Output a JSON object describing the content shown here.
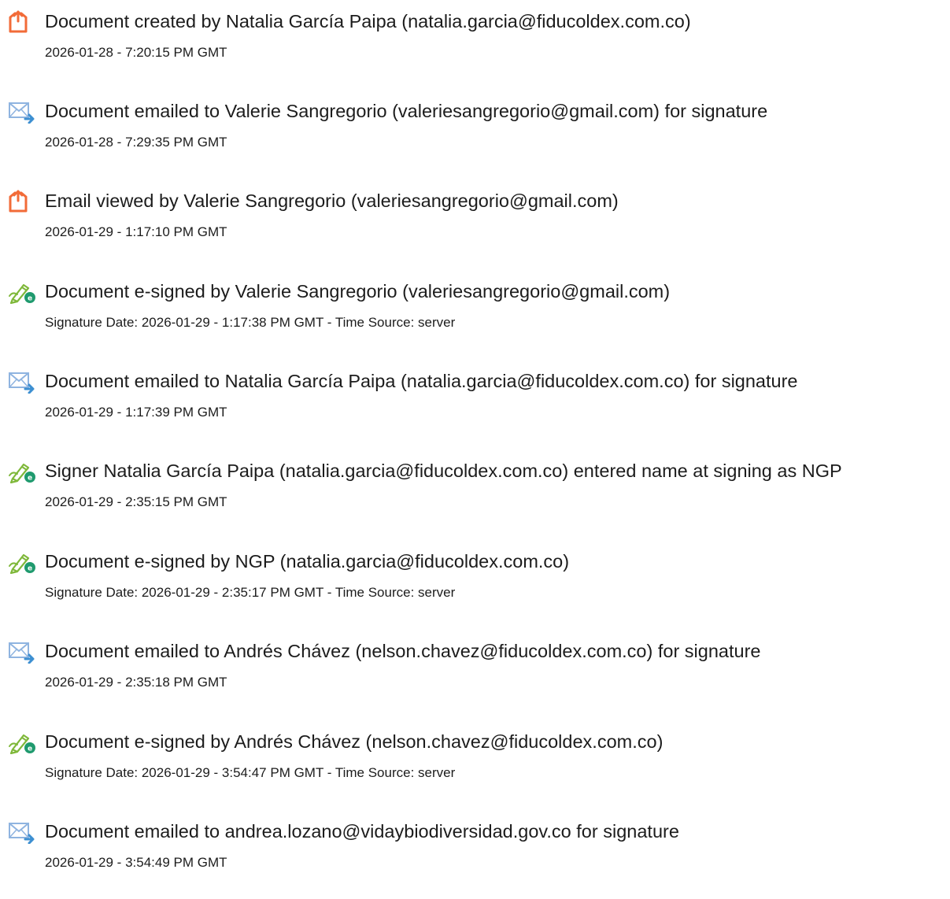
{
  "events": [
    {
      "icon": "document-created-icon",
      "description": "Document created by Natalia García Paipa (natalia.garcia@fiducoldex.com.co)",
      "timestamp": "2026-01-28 - 7:20:15 PM GMT"
    },
    {
      "icon": "email-sent-icon",
      "description": "Document emailed to Valerie Sangregorio (valeriesangregorio@gmail.com) for signature",
      "timestamp": "2026-01-28 - 7:29:35 PM GMT"
    },
    {
      "icon": "document-viewed-icon",
      "description": "Email viewed by Valerie Sangregorio (valeriesangregorio@gmail.com)",
      "timestamp": "2026-01-29 - 1:17:10 PM GMT"
    },
    {
      "icon": "e-sign-icon",
      "description": "Document e-signed by Valerie Sangregorio (valeriesangregorio@gmail.com)",
      "timestamp": "Signature Date: 2026-01-29 - 1:17:38 PM GMT - Time Source: server"
    },
    {
      "icon": "email-sent-icon",
      "description": "Document emailed to Natalia García Paipa (natalia.garcia@fiducoldex.com.co) for signature",
      "timestamp": "2026-01-29 - 1:17:39 PM GMT"
    },
    {
      "icon": "e-sign-icon",
      "description": "Signer Natalia García Paipa (natalia.garcia@fiducoldex.com.co) entered name at signing as NGP",
      "timestamp": "2026-01-29 - 2:35:15 PM GMT"
    },
    {
      "icon": "e-sign-icon",
      "description": "Document e-signed by NGP (natalia.garcia@fiducoldex.com.co)",
      "timestamp": "Signature Date: 2026-01-29 - 2:35:17 PM GMT - Time Source: server"
    },
    {
      "icon": "email-sent-icon",
      "description": "Document emailed to Andrés Chávez (nelson.chavez@fiducoldex.com.co) for signature",
      "timestamp": "2026-01-29 - 2:35:18 PM GMT"
    },
    {
      "icon": "e-sign-icon",
      "description": "Document e-signed by Andrés Chávez (nelson.chavez@fiducoldex.com.co)",
      "timestamp": "Signature Date: 2026-01-29 - 3:54:47 PM GMT - Time Source: server"
    },
    {
      "icon": "email-sent-icon",
      "description": "Document emailed to andrea.lozano@vidaybiodiversidad.gov.co for signature",
      "timestamp": "2026-01-29 - 3:54:49 PM GMT"
    }
  ],
  "colors": {
    "document_icon": "#f26b38",
    "email_icon": "#8fb4e0",
    "email_arrow": "#3d8fd1",
    "sign_pen": "#7fb83a",
    "sign_badge": "#1f9a6e",
    "text": "#1c1c1c"
  }
}
